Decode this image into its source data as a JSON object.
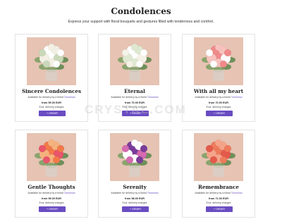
{
  "page": {
    "title": "Condolences",
    "subtitle": "Express your support with floral bouquets and gestures filled with tenderness and comfort."
  },
  "watermark": "CRYSTAL.COM",
  "products": [
    {
      "name": "Sincere Condolences",
      "availability_prefix": "Available for delivery by a florist",
      "availability_when": "Tomorrow",
      "price": "from 59.00 EUR",
      "excl": "Excl. delivery charges",
      "button": "+ ORDER",
      "flower_colors": [
        "#ffffff",
        "#f2efe4",
        "#c9d8b8"
      ]
    },
    {
      "name": "Eternal",
      "availability_prefix": "Available for delivery by a florist",
      "availability_when": "Tomorrow",
      "price": "from 70.00 EUR",
      "excl": "Excl. delivery charges",
      "button": "+ ORDER",
      "flower_colors": [
        "#ffffff",
        "#dfe8d0",
        "#f4f1e6"
      ]
    },
    {
      "name": "With all my heart",
      "availability_prefix": "Available for delivery by a florist",
      "availability_when": "Tomorrow",
      "price": "from 70.00 EUR",
      "excl": "Excl. delivery charges",
      "button": "+ ORDER",
      "flower_colors": [
        "#f08a8a",
        "#f7c2bd",
        "#ffffff"
      ]
    },
    {
      "name": "Gentle Thoughts",
      "availability_prefix": "Available for delivery by a florist",
      "availability_when": "Tomorrow",
      "price": "from 59.00 EUR",
      "excl": "Excl. delivery charges",
      "button": "+ ORDER",
      "flower_colors": [
        "#f27a4a",
        "#f6b27d",
        "#e9556a"
      ]
    },
    {
      "name": "Serenity",
      "availability_prefix": "Available for delivery by a florist",
      "availability_when": "Tomorrow",
      "price": "from 58.00 EUR",
      "excl": "Excl. delivery charges",
      "button": "+ ORDER",
      "flower_colors": [
        "#7a3b9a",
        "#ffffff",
        "#d46ab0"
      ]
    },
    {
      "name": "Remembrance",
      "availability_prefix": "Available for delivery by a florist",
      "availability_when": "Tomorrow",
      "price": "from 71.00 EUR",
      "excl": "Excl. delivery charges",
      "button": "+ ORDER",
      "flower_colors": [
        "#ee7b5c",
        "#f5a48a",
        "#e45a4a"
      ]
    }
  ]
}
